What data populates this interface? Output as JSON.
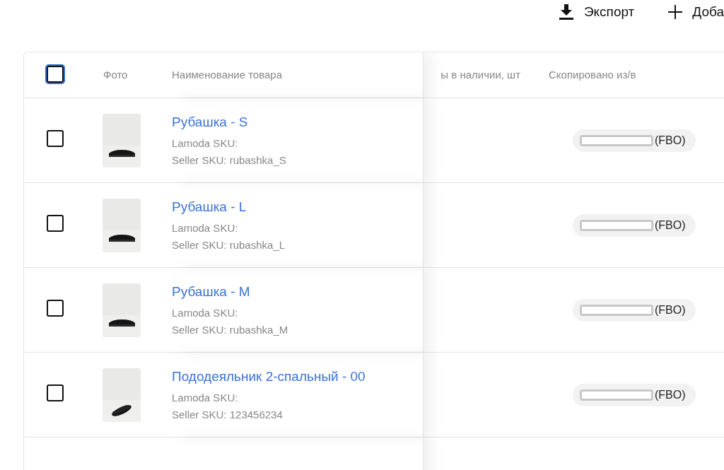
{
  "toolbar": {
    "buttons": [
      {
        "kind": "export",
        "label": "Экспорт"
      },
      {
        "kind": "add",
        "label": "Доба"
      }
    ]
  },
  "table": {
    "header_checkbox": {
      "checked": false,
      "focused": true
    },
    "columns": [
      "Фото",
      "Наименование товара",
      "ы в наличии, шт",
      "Скопировано из/в"
    ],
    "rows": [
      {
        "checked": false,
        "name": "Рубашка - S",
        "lamoda_sku": "Lamoda SKU:",
        "seller_sku": "Seller SKU: rubashka_S",
        "copied": "(FBO)"
      },
      {
        "checked": false,
        "name": "Рубашка - L",
        "lamoda_sku": "Lamoda SKU:",
        "seller_sku": "Seller SKU: rubashka_L",
        "copied": "(FBO)"
      },
      {
        "checked": false,
        "name": "Рубашка - M",
        "lamoda_sku": "Lamoda SKU:",
        "seller_sku": "Seller SKU: rubashka_M",
        "copied": "(FBO)"
      },
      {
        "checked": false,
        "name": "Пододеяльник 2-спальный - 00",
        "lamoda_sku": "Lamoda SKU:",
        "seller_sku": "Seller SKU: 123456234",
        "copied": "(FBO)"
      }
    ]
  }
}
